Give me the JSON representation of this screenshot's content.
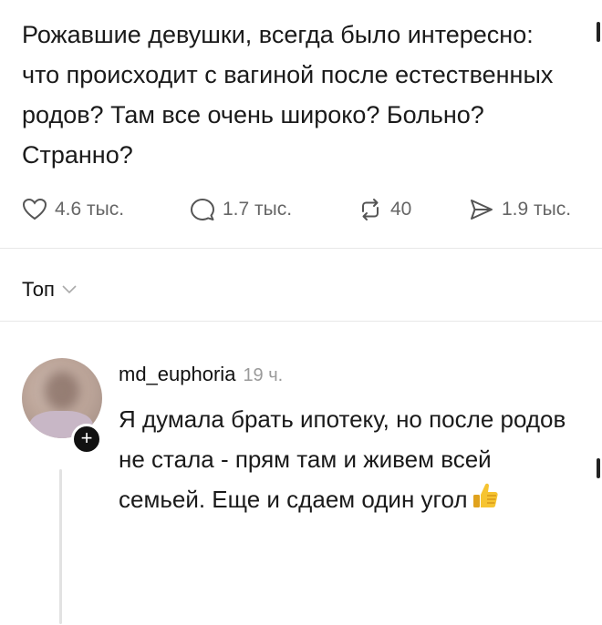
{
  "post": {
    "text": "Рожавшие девушки, всегда было интересно: что происходит с вагиной после естественных родов? Там все очень широко? Больно? Странно?"
  },
  "actions": {
    "likes": "4.6 тыс.",
    "replies": "1.7 тыс.",
    "reposts": "40",
    "shares": "1.9 тыс."
  },
  "sort": {
    "label": "Топ"
  },
  "comment": {
    "username": "md_euphoria",
    "time": "19 ч.",
    "text": "Я думала брать ипотеку, но после родов не стала - прям там и живем всей семьей. Еще и сдаем один угол",
    "emoji": "thumbs-up-icon"
  },
  "colors": {
    "text": "#1a1a1a",
    "muted": "#666666",
    "timestamp": "#9a9a9a",
    "accent": "#111111"
  }
}
